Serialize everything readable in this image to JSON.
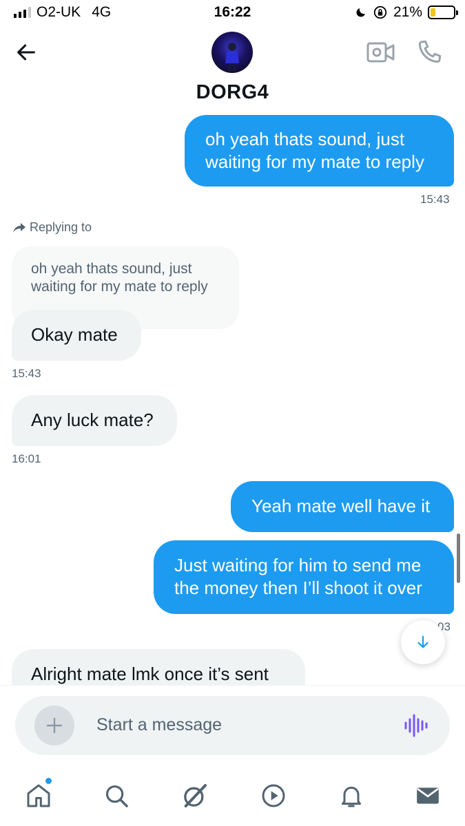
{
  "status_bar": {
    "carrier": "O2-UK",
    "network": "4G",
    "time": "16:22",
    "battery_percent": "21%",
    "battery_level": 0.21,
    "icons": [
      "signal-icon",
      "moon-icon",
      "orientation-lock-icon",
      "battery-icon"
    ]
  },
  "header": {
    "contact_name": "DORG4",
    "icons": [
      "back-arrow-icon",
      "avatar",
      "video-call-icon",
      "phone-icon"
    ]
  },
  "messages": [
    {
      "direction": "out",
      "lines": [
        "oh yeah thats sound, just",
        "waiting for my mate to reply"
      ],
      "time": "15:43"
    },
    {
      "direction": "in",
      "reply_label": "Replying to",
      "quote_lines": [
        "oh yeah thats sound, just",
        "waiting for my mate to reply"
      ],
      "text": "Okay mate",
      "time": "15:43"
    },
    {
      "direction": "in",
      "text": "Any luck mate?",
      "time": "16:01"
    },
    {
      "direction": "out",
      "text": "Yeah mate well have it"
    },
    {
      "direction": "out",
      "lines": [
        "Just waiting for him to send me",
        "the money then I’ll shoot it over"
      ],
      "time": "03"
    },
    {
      "direction": "in",
      "text": "Alright mate lmk once it’s sent"
    }
  ],
  "composer": {
    "placeholder": "Start a message",
    "value": ""
  },
  "bottom_nav": {
    "items": [
      "home-icon",
      "search-icon",
      "grok-icon",
      "video-icon",
      "notifications-icon",
      "messages-icon"
    ],
    "home_has_notification": true
  },
  "colors": {
    "accent": "#1d9bf0",
    "incoming_bubble": "#eff3f4",
    "text_primary": "#0f1419",
    "text_secondary": "#536471",
    "battery_fill": "#f5c518",
    "voice_icon": "#7856ff"
  }
}
